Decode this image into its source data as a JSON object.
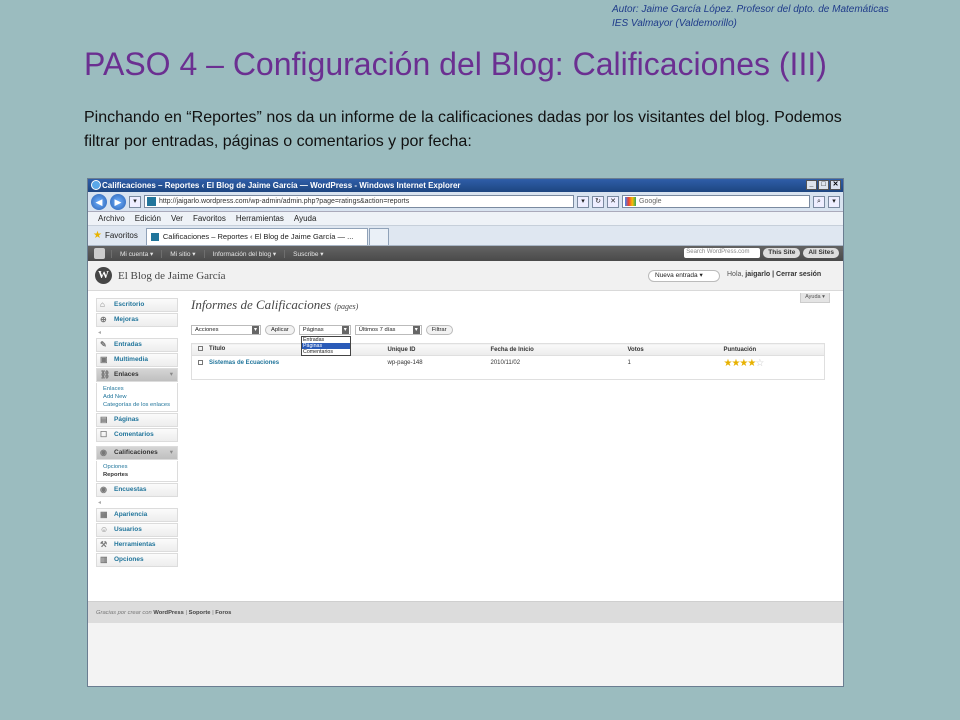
{
  "slide": {
    "author_line1": "Autor: Jaime García López. Profesor del dpto. de Matemáticas",
    "author_line2": "IES Valmayor (Valdemorillo)",
    "title": "PASO 4 – Configuración del Blog: Calificaciones (III)",
    "intro": "Pinchando en “Reportes” nos da un informe de la calificaciones dadas por los visitantes del blog. Podemos filtrar por entradas, páginas o comentarios y por fecha:"
  },
  "browser": {
    "window_title": "Calificaciones – Reportes ‹ El Blog de Jaime García — WordPress - Windows Internet Explorer",
    "address": "http://jaigarlo.wordpress.com/wp-admin/admin.php?page=ratings&action=reports",
    "search_placeholder": "Google",
    "menu": [
      "Archivo",
      "Edición",
      "Ver",
      "Favoritos",
      "Herramientas",
      "Ayuda"
    ],
    "favorites_label": "Favoritos",
    "tab_label": "Calificaciones – Reportes ‹ El Blog de Jaime García — ..."
  },
  "adminbar": {
    "items": [
      "Mi cuenta ▾",
      "Mi sitio ▾",
      "Información del blog ▾",
      "Suscribe ▾"
    ],
    "search_placeholder": "Search WordPress.com",
    "this_site": "This Site",
    "all_sites": "All Sites"
  },
  "wphead": {
    "blog_name": "El Blog de Jaime García",
    "new_entry": "Nueva entrada   ▾",
    "howdy_prefix": "Hola, ",
    "user": "jaigarlo",
    "logout": " | Cerrar sesión",
    "help": "Ayuda ▾"
  },
  "sidebar": {
    "escritorio": "Escritorio",
    "mejoras": "Mejoras",
    "entradas": "Entradas",
    "multimedia": "Multimedia",
    "enlaces": "Enlaces",
    "enlaces_sub": [
      "Enlaces",
      "Add New",
      "Categorías de los enlaces"
    ],
    "paginas": "Páginas",
    "comentarios": "Comentarios",
    "calificaciones": "Calificaciones",
    "calif_sub": [
      "Opciones",
      "Reportes"
    ],
    "encuestas": "Encuestas",
    "apariencia": "Apariencia",
    "usuarios": "Usuarios",
    "herramientas": "Herramientas",
    "opciones": "Opciones"
  },
  "content": {
    "heading": "Informes de Calificaciones",
    "heading_sub": "(pages)",
    "bulk_select": "Acciones",
    "apply": "Aplicar",
    "type_select": "Páginas",
    "type_options": [
      "Entradas",
      "Páginas",
      "Comentarios"
    ],
    "date_select": "Últimos 7 días",
    "filter": "Filtrar",
    "columns": [
      "Título",
      "Unique ID",
      "Fecha de Inicio",
      "Votos",
      "Puntuación"
    ],
    "rows": [
      {
        "title": "Sistemas de Ecuaciones",
        "unique_id": "wp-page-148",
        "start_date": "2010/11/02",
        "votes": "1",
        "rating": 4
      }
    ]
  },
  "footer": {
    "thanks": "Gracias por crear con ",
    "wordpress": "WordPress",
    "sep1": " | ",
    "soporte": "Soporte",
    "sep2": " | ",
    "foros": "Foros"
  }
}
